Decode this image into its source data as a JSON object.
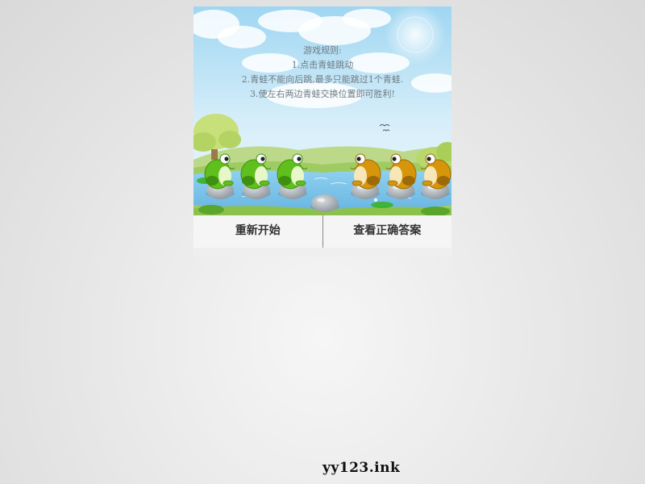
{
  "rules": {
    "title": "游戏规则:",
    "lines": [
      "1.点击青蛙跳动",
      "2.青蛙不能向后跳,最多只能跳过1个青蛙.",
      "3.使左右两边青蛙交换位置即可胜利!"
    ]
  },
  "board": {
    "stones": 7,
    "positions": [
      "green",
      "green",
      "green",
      "empty",
      "orange",
      "orange",
      "orange"
    ]
  },
  "colors": {
    "green_frog": "#5fbf1c",
    "orange_frog": "#d7950b",
    "water": "#7ec4ea",
    "sky": "#b9e2f7"
  },
  "controls": {
    "restart_label": "重新开始",
    "answer_label": "查看正确答案"
  },
  "footer": {
    "site": "yy123.ink"
  }
}
